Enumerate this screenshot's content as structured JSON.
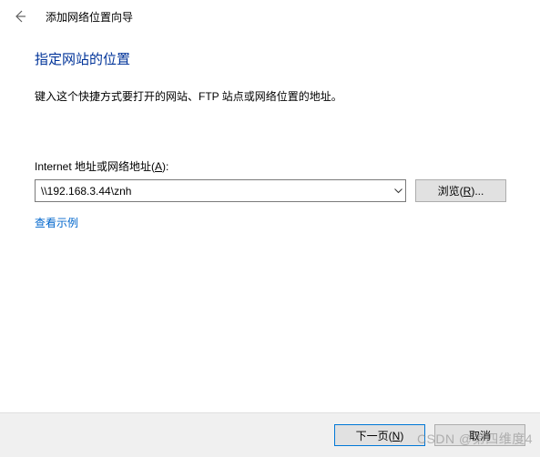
{
  "header": {
    "title": "添加网络位置向导"
  },
  "content": {
    "heading": "指定网站的位置",
    "description": "键入这个快捷方式要打开的网站、FTP 站点或网络位置的地址。",
    "address_label_prefix": "Internet 地址或网络地址(",
    "address_label_key": "A",
    "address_label_suffix": "):",
    "address_value": "\\\\192.168.3.44\\znh",
    "browse_label_prefix": "浏览(",
    "browse_label_key": "R",
    "browse_label_suffix": ")...",
    "example_link": "查看示例"
  },
  "footer": {
    "next_prefix": "下一页(",
    "next_key": "N",
    "next_suffix": ")",
    "cancel_label": "取消"
  },
  "watermark": "CSDN @第四维度4"
}
